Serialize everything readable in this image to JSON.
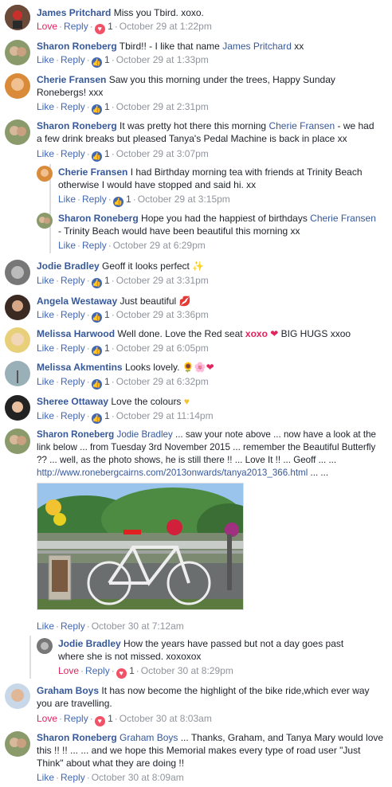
{
  "comments": [
    {
      "author": "James Pritchard",
      "text": " Miss you Tbird. xoxo.",
      "act1": "Love",
      "act2": "Reply",
      "react": "love",
      "count": "1",
      "time": "October 29 at 1:22pm"
    },
    {
      "author": "Sharon Roneberg",
      "text": " Tbird!! - I like that name ",
      "mention_after": "James Pritchard",
      "text2": " xx",
      "act1": "Like",
      "act2": "Reply",
      "react": "like",
      "count": "1",
      "time": "October 29 at 1:33pm"
    },
    {
      "author": "Cherie Fransen",
      "text": " Saw you this morning under the trees, Happy Sunday Ronebergs! xxx",
      "act1": "Like",
      "act2": "Reply",
      "react": "like",
      "count": "1",
      "time": "October 29 at 2:31pm"
    },
    {
      "author": "Sharon Roneberg",
      "text": " It was pretty hot there this morning ",
      "mention_after": "Cherie Fransen",
      "text2": " - we had a few drink breaks but pleased Tanya's Pedal Machine is back in place xx",
      "act1": "Like",
      "act2": "Reply",
      "react": "like",
      "count": "1",
      "time": "October 29 at 3:07pm"
    },
    {
      "author": "Cherie Fransen",
      "text": " I had Birthday morning tea with friends at Trinity Beach otherwise I would have stopped and said hi. xx",
      "act1": "Like",
      "act2": "Reply",
      "react": "like",
      "count": "1",
      "time": "October 29 at 3:15pm"
    },
    {
      "author": "Sharon Roneberg",
      "text": " Hope you had the happiest of birthdays ",
      "mention_after": "Cherie Fransen",
      "text2": " - Trinity Beach would have been beautiful this morning xx",
      "act1": "Like",
      "act2": "Reply",
      "time": "October 29 at 6:29pm"
    },
    {
      "author": "Jodie Bradley",
      "text": " Geoff it looks perfect ",
      "act1": "Like",
      "act2": "Reply",
      "react": "like",
      "count": "1",
      "time": "October 29 at 3:31pm"
    },
    {
      "author": "Angela Westaway",
      "text": " Just beautiful ",
      "act1": "Like",
      "act2": "Reply",
      "react": "like",
      "count": "1",
      "time": "October 29 at 3:36pm"
    },
    {
      "author": "Melissa Harwood",
      "text": " Well done. Love the Red seat ",
      "red": "xoxo",
      "text2": " BIG HUGS xxoo",
      "act1": "Like",
      "act2": "Reply",
      "react": "like",
      "count": "1",
      "time": "October 29 at 6:05pm"
    },
    {
      "author": "Melissa Akmentins",
      "text": " Looks lovely. ",
      "act1": "Like",
      "act2": "Reply",
      "react": "like",
      "count": "1",
      "time": "October 29 at 6:32pm"
    },
    {
      "author": "Sheree Ottaway",
      "text": " Love the colours ",
      "act1": "Like",
      "act2": "Reply",
      "react": "like",
      "count": "1",
      "time": "October 29 at 11:14pm"
    },
    {
      "author": "Sharon Roneberg",
      "mention_first": "Jodie Bradley",
      "text": " ... saw your note above ... now have a look at the link below ... from Tuesday 3rd November 2015 ... remember the Beautiful Butterfly ?? ... well, as the photo shows, he is still there !! ... Love It !! ... Geoff ... ... ",
      "link": "http://www.ronebergcairns.com/2013onwards/tanya2013_366.html",
      "text2": " ... ...",
      "act1": "Like",
      "act2": "Reply",
      "time": "October 30 at 7:12am"
    },
    {
      "author": "Jodie Bradley",
      "text": " How the years have passed but not a day goes past where she is not missed. xoxoxox",
      "act1": "Love",
      "act2": "Reply",
      "react": "love",
      "count": "1",
      "time": "October 30 at 8:29pm"
    },
    {
      "author": "Graham Boys",
      "text": " It has now become the highlight of the bike ride,which ever way you are travelling.",
      "act1": "Love",
      "act2": "Reply",
      "react": "love",
      "count": "1",
      "time": "October 30 at 8:03am"
    },
    {
      "author": "Sharon Roneberg",
      "mention_first": "Graham Boys",
      "text": " ... Thanks, Graham, and Tanya Mary would love this !! !! ... ... and we hope this Memorial makes every type of road user \"Just Think\" about what they are doing !!",
      "act1": "Like",
      "act2": "Reply",
      "time": "October 30 at 8:09am"
    }
  ],
  "colors": {
    "link": "#365899",
    "like": "#4267b2",
    "love": "#e0245e",
    "meta": "#90949c"
  }
}
